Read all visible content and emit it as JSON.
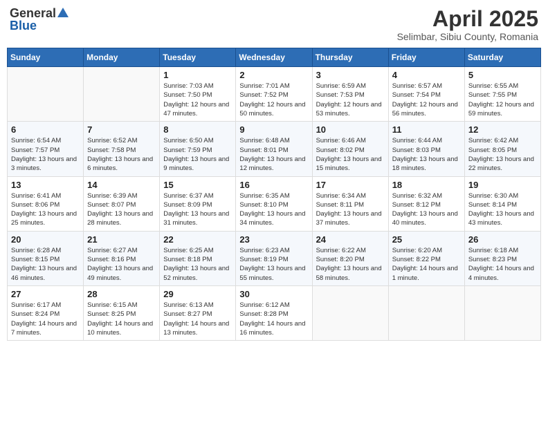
{
  "header": {
    "logo_general": "General",
    "logo_blue": "Blue",
    "title": "April 2025",
    "subtitle": "Selimbar, Sibiu County, Romania"
  },
  "days_of_week": [
    "Sunday",
    "Monday",
    "Tuesday",
    "Wednesday",
    "Thursday",
    "Friday",
    "Saturday"
  ],
  "weeks": [
    [
      {
        "day": "",
        "detail": ""
      },
      {
        "day": "",
        "detail": ""
      },
      {
        "day": "1",
        "detail": "Sunrise: 7:03 AM\nSunset: 7:50 PM\nDaylight: 12 hours\nand 47 minutes."
      },
      {
        "day": "2",
        "detail": "Sunrise: 7:01 AM\nSunset: 7:52 PM\nDaylight: 12 hours\nand 50 minutes."
      },
      {
        "day": "3",
        "detail": "Sunrise: 6:59 AM\nSunset: 7:53 PM\nDaylight: 12 hours\nand 53 minutes."
      },
      {
        "day": "4",
        "detail": "Sunrise: 6:57 AM\nSunset: 7:54 PM\nDaylight: 12 hours\nand 56 minutes."
      },
      {
        "day": "5",
        "detail": "Sunrise: 6:55 AM\nSunset: 7:55 PM\nDaylight: 12 hours\nand 59 minutes."
      }
    ],
    [
      {
        "day": "6",
        "detail": "Sunrise: 6:54 AM\nSunset: 7:57 PM\nDaylight: 13 hours\nand 3 minutes."
      },
      {
        "day": "7",
        "detail": "Sunrise: 6:52 AM\nSunset: 7:58 PM\nDaylight: 13 hours\nand 6 minutes."
      },
      {
        "day": "8",
        "detail": "Sunrise: 6:50 AM\nSunset: 7:59 PM\nDaylight: 13 hours\nand 9 minutes."
      },
      {
        "day": "9",
        "detail": "Sunrise: 6:48 AM\nSunset: 8:01 PM\nDaylight: 13 hours\nand 12 minutes."
      },
      {
        "day": "10",
        "detail": "Sunrise: 6:46 AM\nSunset: 8:02 PM\nDaylight: 13 hours\nand 15 minutes."
      },
      {
        "day": "11",
        "detail": "Sunrise: 6:44 AM\nSunset: 8:03 PM\nDaylight: 13 hours\nand 18 minutes."
      },
      {
        "day": "12",
        "detail": "Sunrise: 6:42 AM\nSunset: 8:05 PM\nDaylight: 13 hours\nand 22 minutes."
      }
    ],
    [
      {
        "day": "13",
        "detail": "Sunrise: 6:41 AM\nSunset: 8:06 PM\nDaylight: 13 hours\nand 25 minutes."
      },
      {
        "day": "14",
        "detail": "Sunrise: 6:39 AM\nSunset: 8:07 PM\nDaylight: 13 hours\nand 28 minutes."
      },
      {
        "day": "15",
        "detail": "Sunrise: 6:37 AM\nSunset: 8:09 PM\nDaylight: 13 hours\nand 31 minutes."
      },
      {
        "day": "16",
        "detail": "Sunrise: 6:35 AM\nSunset: 8:10 PM\nDaylight: 13 hours\nand 34 minutes."
      },
      {
        "day": "17",
        "detail": "Sunrise: 6:34 AM\nSunset: 8:11 PM\nDaylight: 13 hours\nand 37 minutes."
      },
      {
        "day": "18",
        "detail": "Sunrise: 6:32 AM\nSunset: 8:12 PM\nDaylight: 13 hours\nand 40 minutes."
      },
      {
        "day": "19",
        "detail": "Sunrise: 6:30 AM\nSunset: 8:14 PM\nDaylight: 13 hours\nand 43 minutes."
      }
    ],
    [
      {
        "day": "20",
        "detail": "Sunrise: 6:28 AM\nSunset: 8:15 PM\nDaylight: 13 hours\nand 46 minutes."
      },
      {
        "day": "21",
        "detail": "Sunrise: 6:27 AM\nSunset: 8:16 PM\nDaylight: 13 hours\nand 49 minutes."
      },
      {
        "day": "22",
        "detail": "Sunrise: 6:25 AM\nSunset: 8:18 PM\nDaylight: 13 hours\nand 52 minutes."
      },
      {
        "day": "23",
        "detail": "Sunrise: 6:23 AM\nSunset: 8:19 PM\nDaylight: 13 hours\nand 55 minutes."
      },
      {
        "day": "24",
        "detail": "Sunrise: 6:22 AM\nSunset: 8:20 PM\nDaylight: 13 hours\nand 58 minutes."
      },
      {
        "day": "25",
        "detail": "Sunrise: 6:20 AM\nSunset: 8:22 PM\nDaylight: 14 hours\nand 1 minute."
      },
      {
        "day": "26",
        "detail": "Sunrise: 6:18 AM\nSunset: 8:23 PM\nDaylight: 14 hours\nand 4 minutes."
      }
    ],
    [
      {
        "day": "27",
        "detail": "Sunrise: 6:17 AM\nSunset: 8:24 PM\nDaylight: 14 hours\nand 7 minutes."
      },
      {
        "day": "28",
        "detail": "Sunrise: 6:15 AM\nSunset: 8:25 PM\nDaylight: 14 hours\nand 10 minutes."
      },
      {
        "day": "29",
        "detail": "Sunrise: 6:13 AM\nSunset: 8:27 PM\nDaylight: 14 hours\nand 13 minutes."
      },
      {
        "day": "30",
        "detail": "Sunrise: 6:12 AM\nSunset: 8:28 PM\nDaylight: 14 hours\nand 16 minutes."
      },
      {
        "day": "",
        "detail": ""
      },
      {
        "day": "",
        "detail": ""
      },
      {
        "day": "",
        "detail": ""
      }
    ]
  ]
}
